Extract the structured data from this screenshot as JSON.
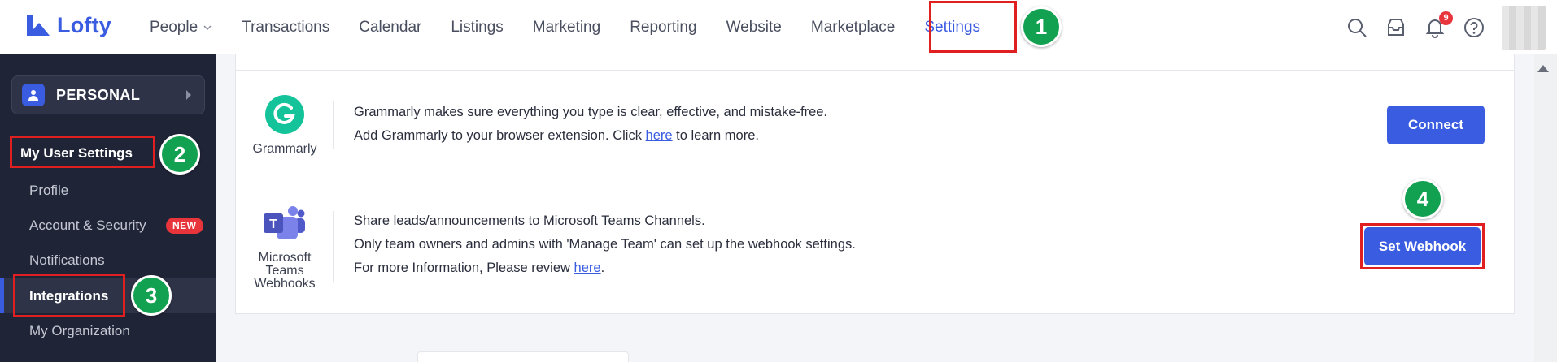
{
  "app": {
    "logo_text": "Lofty"
  },
  "nav": {
    "items": [
      {
        "label": "People"
      },
      {
        "label": "Transactions"
      },
      {
        "label": "Calendar"
      },
      {
        "label": "Listings"
      },
      {
        "label": "Marketing"
      },
      {
        "label": "Reporting"
      },
      {
        "label": "Website"
      },
      {
        "label": "Marketplace"
      },
      {
        "label": "Settings"
      }
    ],
    "active": "Settings",
    "notification_count": "9"
  },
  "sidebar": {
    "workspace": "PERSONAL",
    "section_title": "My User Settings",
    "items": [
      {
        "label": "Profile"
      },
      {
        "label": "Account & Security",
        "badge": "NEW"
      },
      {
        "label": "Notifications"
      },
      {
        "label": "Integrations"
      },
      {
        "label": "My Organization"
      }
    ],
    "active_item": "Integrations"
  },
  "steps": [
    "1",
    "2",
    "3",
    "4"
  ],
  "integrations": [
    {
      "name": "Grammarly",
      "line1": "Grammarly makes sure everything you type is clear, effective, and mistake-free.",
      "line2_pre": "Add Grammarly to your browser extension. Click ",
      "line2_link": "here",
      "line2_post": " to learn more.",
      "button": "Connect"
    },
    {
      "name_line1": "Microsoft",
      "name_line2": "Teams",
      "name_line3": "Webhooks",
      "line1": "Share leads/announcements to Microsoft Teams Channels.",
      "line2": "Only team owners and admins with 'Manage Team' can set up the webhook settings.",
      "line3_pre": "For more Information, Please review ",
      "line3_link": "here",
      "line3_post": ".",
      "button": "Set Webhook"
    }
  ],
  "colors": {
    "accent": "#3a5ce0",
    "sidebar_bg": "#202437",
    "highlight_red": "#e02020",
    "step_green": "#12a150"
  }
}
